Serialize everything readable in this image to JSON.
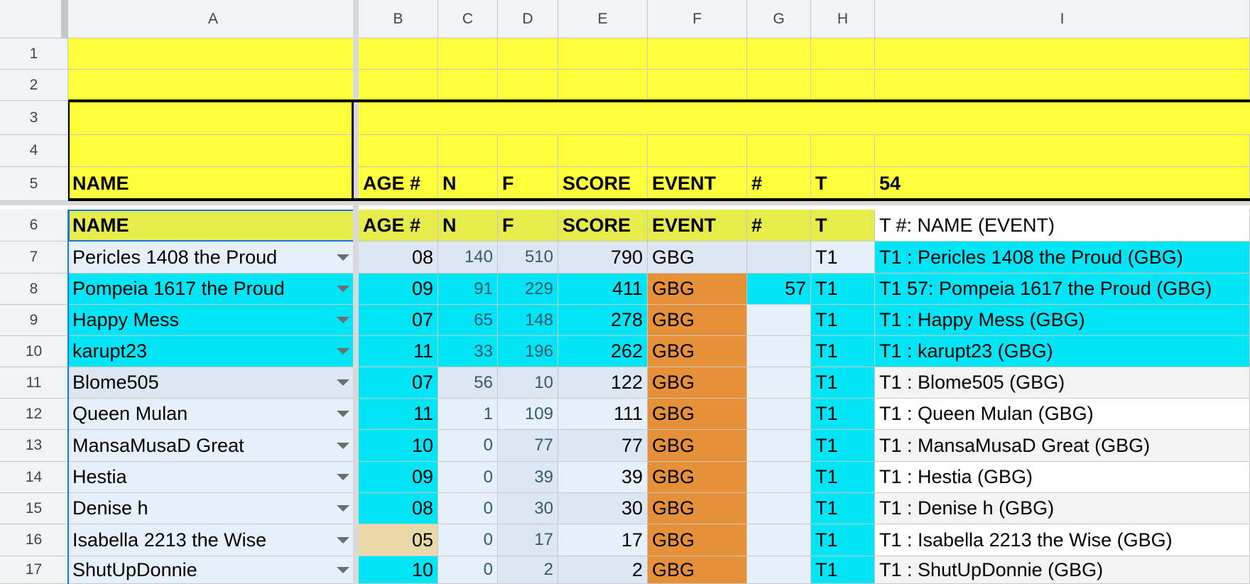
{
  "columns": [
    "A",
    "B",
    "C",
    "D",
    "E",
    "F",
    "G",
    "H",
    "I"
  ],
  "rows": [
    "1",
    "2",
    "3",
    "4",
    "5",
    "6",
    "7",
    "8",
    "9",
    "10",
    "11",
    "12",
    "13",
    "14",
    "15",
    "16",
    "17"
  ],
  "header_row5": {
    "name": "NAME",
    "age": "AGE #",
    "n": "N",
    "f": "F",
    "score": "SCORE",
    "event": "EVENT",
    "num": "#",
    "t": "T",
    "i": "54"
  },
  "header_row6": {
    "name": "NAME",
    "age": "AGE #",
    "n": "N",
    "f": "F",
    "score": "SCORE",
    "event": "EVENT",
    "num": "#",
    "t": "T",
    "i": "T #: NAME (EVENT)"
  },
  "data_rows": [
    {
      "name": "Pericles 1408 the Proud",
      "age": "08",
      "n": "140",
      "f": "510",
      "score": "790",
      "event": "GBG",
      "num": "",
      "t": "T1",
      "label": "T1 : Pericles 1408 the Proud (GBG)"
    },
    {
      "name": "Pompeia 1617 the Proud",
      "age": "09",
      "n": "91",
      "f": "229",
      "score": "411",
      "event": "GBG",
      "num": "57",
      "t": "T1",
      "label": "T1 57: Pompeia 1617 the Proud (GBG)"
    },
    {
      "name": "Happy Mess",
      "age": "07",
      "n": "65",
      "f": "148",
      "score": "278",
      "event": "GBG",
      "num": "",
      "t": "T1",
      "label": "T1 : Happy Mess (GBG)"
    },
    {
      "name": "karupt23",
      "age": "11",
      "n": "33",
      "f": "196",
      "score": "262",
      "event": "GBG",
      "num": "",
      "t": "T1",
      "label": "T1 : karupt23 (GBG)"
    },
    {
      "name": "Blome505",
      "age": "07",
      "n": "56",
      "f": "10",
      "score": "122",
      "event": "GBG",
      "num": "",
      "t": "T1",
      "label": "T1 : Blome505 (GBG)"
    },
    {
      "name": "Queen Mulan",
      "age": "11",
      "n": "1",
      "f": "109",
      "score": "111",
      "event": "GBG",
      "num": "",
      "t": "T1",
      "label": "T1 : Queen Mulan (GBG)"
    },
    {
      "name": "MansaMusaD Great",
      "age": "10",
      "n": "0",
      "f": "77",
      "score": "77",
      "event": "GBG",
      "num": "",
      "t": "T1",
      "label": "T1 : MansaMusaD Great (GBG)"
    },
    {
      "name": "Hestia",
      "age": "09",
      "n": "0",
      "f": "39",
      "score": "39",
      "event": "GBG",
      "num": "",
      "t": "T1",
      "label": "T1 : Hestia (GBG)"
    },
    {
      "name": "Denise h",
      "age": "08",
      "n": "0",
      "f": "30",
      "score": "30",
      "event": "GBG",
      "num": "",
      "t": "T1",
      "label": "T1 : Denise h (GBG)"
    },
    {
      "name": "Isabella 2213 the Wise",
      "age": "05",
      "n": "0",
      "f": "17",
      "score": "17",
      "event": "GBG",
      "num": "",
      "t": "T1",
      "label": "T1 : Isabella 2213 the Wise (GBG)"
    },
    {
      "name": "ShutUpDonnie",
      "age": "10",
      "n": "0",
      "f": "2",
      "score": "2",
      "event": "GBG",
      "num": "",
      "t": "T1",
      "label": "T1 : ShutUpDonnie (GBG)"
    }
  ],
  "colors": {
    "yellow": "#ffff3b",
    "header_green_yellow": "#e6ec4c",
    "cyan": "#00e5f5",
    "light_blue": "#dce7f3",
    "pale_blue": "#e6f0fb",
    "orange": "#e69138",
    "tan": "#ead8a8",
    "pale_gray": "#f3f3f3",
    "white": "#ffffff",
    "header_bg": "#f1f3f4"
  }
}
